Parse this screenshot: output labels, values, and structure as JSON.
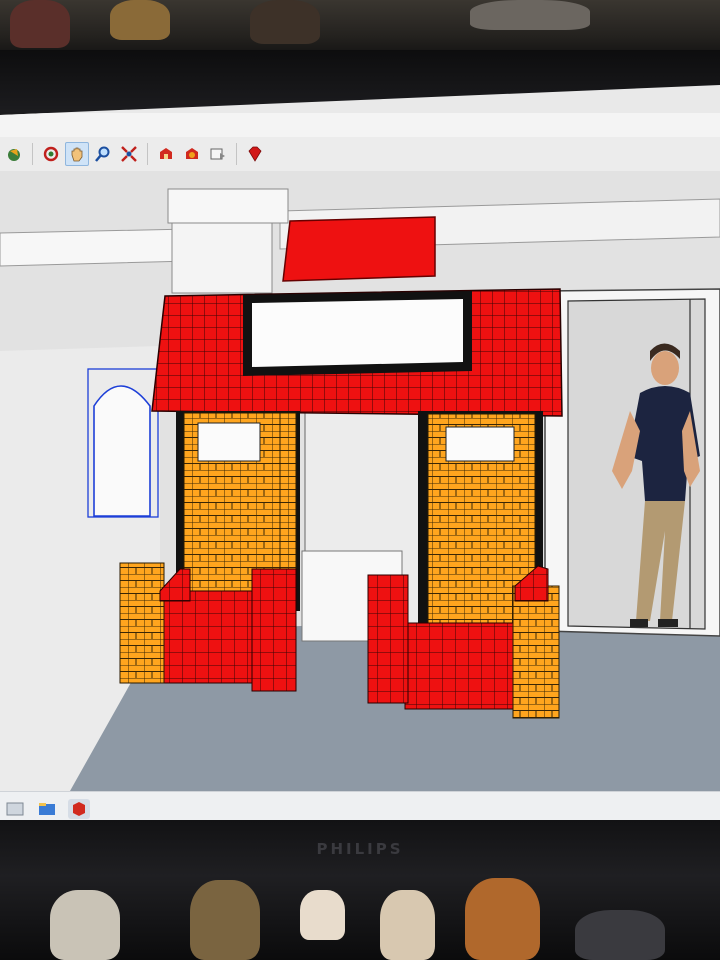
{
  "device": {
    "brand": "PHILIPS"
  },
  "toolbar": {
    "tools": [
      {
        "name": "select-tool-icon"
      },
      {
        "name": "orbit-tool-icon"
      },
      {
        "name": "pan-tool-icon",
        "active": true
      },
      {
        "name": "zoom-tool-icon"
      },
      {
        "name": "zoom-extents-tool-icon"
      },
      {
        "name": "3d-warehouse-icon"
      },
      {
        "name": "extension-warehouse-icon"
      },
      {
        "name": "send-to-layout-icon"
      },
      {
        "name": "ruby-console-icon"
      }
    ]
  },
  "taskbar": {
    "items": [
      {
        "name": "desktop-shortcut-icon"
      },
      {
        "name": "explorer-icon"
      },
      {
        "name": "sketchup-taskbar-icon"
      }
    ]
  },
  "colors": {
    "roof_red": "#ee1111",
    "pillar_orange": "#ffa51e",
    "floor": "#8d98a4",
    "wall": "#e4e4e4",
    "selection_blue": "#1d3fd8"
  }
}
